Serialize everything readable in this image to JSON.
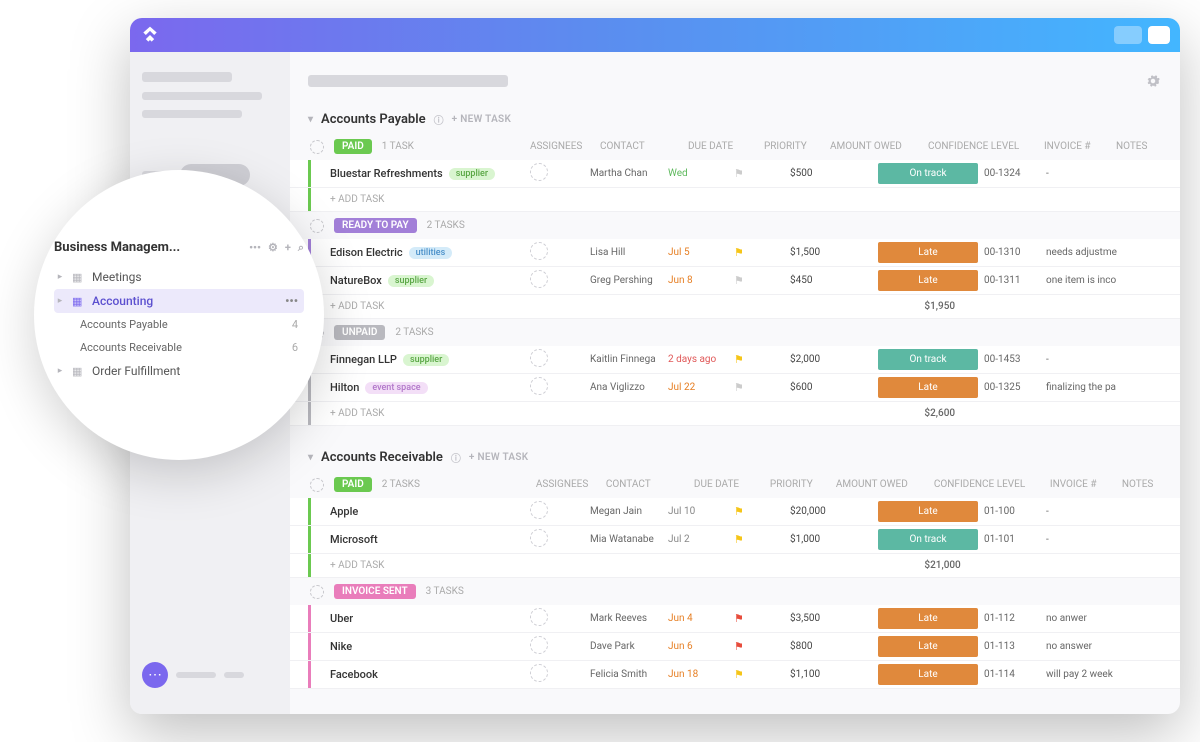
{
  "popover": {
    "title": "Business Managem...",
    "items": [
      {
        "label": "Meetings"
      },
      {
        "label": "Accounting",
        "selected": true,
        "children": [
          {
            "label": "Accounts Payable",
            "count": "4"
          },
          {
            "label": "Accounts Receivable",
            "count": "6"
          }
        ]
      },
      {
        "label": "Order Fulfillment"
      }
    ]
  },
  "sections": [
    {
      "title": "Accounts Payable",
      "newtask": "+ NEW TASK",
      "groups": [
        {
          "status": "PAID",
          "chip_class": "chip-green",
          "bar_class": "bar-green",
          "count": "1 TASK",
          "headers": true,
          "rows": [
            {
              "task": "Bluestar Refreshments",
              "tag": "supplier",
              "tag_class": "tag-supplier",
              "contact": "Martha Chan",
              "due": "Wed",
              "due_class": "due-green",
              "flag_class": "flag-gray",
              "amount": "$500",
              "confidence": "On track",
              "conf_class": "conf-ontrack",
              "invoice": "00-1324",
              "notes": "-"
            }
          ],
          "add": "+ ADD TASK"
        },
        {
          "status": "READY TO PAY",
          "chip_class": "chip-purple",
          "bar_class": "bar-purple",
          "count": "2 TASKS",
          "rows": [
            {
              "task": "Edison Electric",
              "tag": "utilities",
              "tag_class": "tag-utilities",
              "contact": "Lisa Hill",
              "due": "Jul 5",
              "due_class": "due-orange",
              "flag_class": "flag-yellow",
              "amount": "$1,500",
              "confidence": "Late",
              "conf_class": "conf-late",
              "invoice": "00-1310",
              "notes": "needs adjustme"
            },
            {
              "task": "NatureBox",
              "tag": "supplier",
              "tag_class": "tag-supplier",
              "contact": "Greg Pershing",
              "due": "Jun 8",
              "due_class": "due-orange",
              "flag_class": "flag-gray",
              "amount": "$450",
              "confidence": "Late",
              "conf_class": "conf-late",
              "invoice": "00-1311",
              "notes": "one item is inco"
            }
          ],
          "add": "+ ADD TASK",
          "subtotal": "$1,950"
        },
        {
          "status": "UNPAID",
          "chip_class": "chip-gray",
          "bar_class": "bar-gray",
          "count": "2 TASKS",
          "rows": [
            {
              "task": "Finnegan LLP",
              "tag": "supplier",
              "tag_class": "tag-supplier",
              "contact": "Kaitlin Finnega",
              "due": "2 days ago",
              "due_class": "due-red",
              "flag_class": "flag-yellow",
              "amount": "$2,000",
              "confidence": "On track",
              "conf_class": "conf-ontrack",
              "invoice": "00-1453",
              "notes": "-"
            },
            {
              "task": "Hilton",
              "tag": "event space",
              "tag_class": "tag-event",
              "contact": "Ana Viglizzo",
              "due": "Jul 22",
              "due_class": "due-orange",
              "flag_class": "flag-gray",
              "amount": "$600",
              "confidence": "Late",
              "conf_class": "conf-late",
              "invoice": "00-1325",
              "notes": "finalizing the pa"
            }
          ],
          "add": "+ ADD TASK",
          "subtotal": "$2,600"
        }
      ]
    },
    {
      "title": "Accounts Receivable",
      "newtask": "+ NEW TASK",
      "groups": [
        {
          "status": "PAID",
          "chip_class": "chip-green",
          "bar_class": "bar-green",
          "count": "2 TASKS",
          "headers": true,
          "rows": [
            {
              "task": "Apple",
              "contact": "Megan Jain",
              "due": "Jul 10",
              "due_class": "due-gray",
              "flag_class": "flag-yellow",
              "amount": "$20,000",
              "confidence": "Late",
              "conf_class": "conf-late",
              "invoice": "01-100",
              "notes": "-"
            },
            {
              "task": "Microsoft",
              "contact": "Mia Watanabe",
              "due": "Jul 2",
              "due_class": "due-gray",
              "flag_class": "flag-yellow",
              "amount": "$1,000",
              "confidence": "On track",
              "conf_class": "conf-ontrack",
              "invoice": "01-101",
              "notes": "-"
            }
          ],
          "add": "+ ADD TASK",
          "subtotal": "$21,000"
        },
        {
          "status": "INVOICE SENT",
          "chip_class": "chip-pink",
          "bar_class": "bar-pink",
          "count": "3 TASKS",
          "rows": [
            {
              "task": "Uber",
              "contact": "Mark Reeves",
              "due": "Jun 4",
              "due_class": "due-orange",
              "flag_class": "flag-red",
              "amount": "$3,500",
              "confidence": "Late",
              "conf_class": "conf-late",
              "invoice": "01-112",
              "notes": "no anwer"
            },
            {
              "task": "Nike",
              "contact": "Dave Park",
              "due": "Jun 6",
              "due_class": "due-orange",
              "flag_class": "flag-red",
              "amount": "$800",
              "confidence": "Late",
              "conf_class": "conf-late",
              "invoice": "01-113",
              "notes": "no answer"
            },
            {
              "task": "Facebook",
              "contact": "Felicia Smith",
              "due": "Jun 18",
              "due_class": "due-orange",
              "flag_class": "flag-yellow",
              "amount": "$1,100",
              "confidence": "Late",
              "conf_class": "conf-late",
              "invoice": "01-114",
              "notes": "will pay 2 week"
            }
          ]
        }
      ]
    }
  ],
  "columns": {
    "assignees": "ASSIGNEES",
    "contact": "CONTACT",
    "due": "DUE DATE",
    "priority": "PRIORITY",
    "amount": "AMOUNT OWED",
    "confidence": "CONFIDENCE LEVEL",
    "invoice": "INVOICE #",
    "notes": "NOTES"
  }
}
